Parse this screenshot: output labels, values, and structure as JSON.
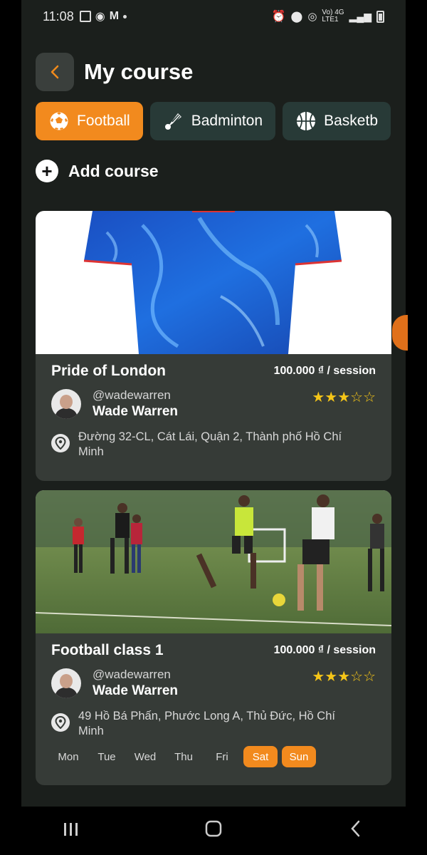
{
  "status_bar": {
    "time": "11:08",
    "network_small": "Vo) 4G",
    "network_small2": "LTE1"
  },
  "header": {
    "back_icon": "chevron-left-icon",
    "title": "My course"
  },
  "tabs": [
    {
      "label": "Football",
      "icon": "soccer-ball-icon",
      "active": true
    },
    {
      "label": "Badminton",
      "icon": "shuttlecock-icon",
      "active": false
    },
    {
      "label": "Basketb",
      "icon": "basketball-icon",
      "active": false
    }
  ],
  "add_course": {
    "label": "Add course"
  },
  "courses": [
    {
      "name": "Pride of London",
      "price": "100.000 ₫ / session",
      "handle": "@wadewarren",
      "owner": "Wade Warren",
      "rating": 3,
      "rating_max": 5,
      "address_line1": "Đường 32-CL, Cát Lái, Quận 2, Thành phố Hồ Chí",
      "address_line2": "Minh"
    },
    {
      "name": "Football class 1",
      "price": "100.000 ₫ / session",
      "handle": "@wadewarren",
      "owner": "Wade Warren",
      "rating": 3,
      "rating_max": 5,
      "address_line1": "49 Hồ Bá Phấn, Phước Long A, Thủ Đức, Hồ Chí",
      "address_line2": "Minh",
      "days": [
        {
          "label": "Mon",
          "selected": false
        },
        {
          "label": "Tue",
          "selected": false
        },
        {
          "label": "Wed",
          "selected": false
        },
        {
          "label": "Thu",
          "selected": false
        },
        {
          "label": "Fri",
          "selected": false
        },
        {
          "label": "Sat",
          "selected": true
        },
        {
          "label": "Sun",
          "selected": true
        }
      ]
    }
  ],
  "colors": {
    "accent": "#f28a1e",
    "background": "#1b1f1c",
    "card": "#363b37",
    "inactive_tab": "#283a37",
    "star": "#f5c518"
  }
}
